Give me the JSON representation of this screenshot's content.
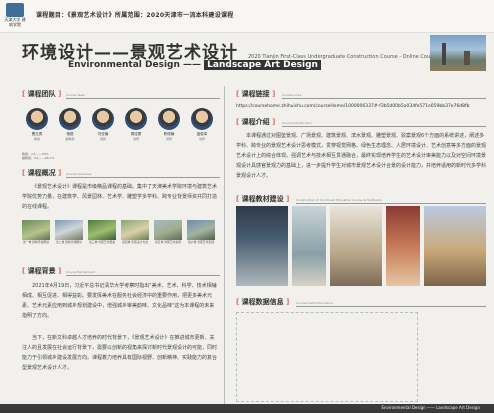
{
  "topbar": {
    "logo_text": "天津大学\n建筑学院",
    "title": "课程题目：《景观艺术设计》所属范围：2020天津市一流本科建设课程"
  },
  "header": {
    "title_cn": "环境设计——景观艺术设计",
    "title_en_prefix": "Environmental Design —— ",
    "title_en_highlight": "Landscape Art Design",
    "subtitle_en": "2020 Tianjin First-Class Undergraduate Construction Course - Online Courses -"
  },
  "sections": {
    "team": {
      "title": "课程团队",
      "sub": "Course Team"
    },
    "overview": {
      "title": "课程概况",
      "sub": "Course Overview"
    },
    "background": {
      "title": "课程背景",
      "sub": "Course Background"
    },
    "link": {
      "title": "课程链接",
      "sub": "Course Links"
    },
    "intro": {
      "title": "课程介绍",
      "sub": "Course Introduction"
    },
    "materials": {
      "title": "课程教材建设",
      "sub": "Construction of Continued Education Course & Textbooks"
    },
    "data": {
      "title": "课程数据信息",
      "sub": "Course Data Information"
    }
  },
  "team_members": [
    {
      "name": "曹文勇",
      "role": "教授"
    },
    {
      "name": "杨振",
      "role": "副教授"
    },
    {
      "name": "刘亚楠",
      "role": "讲师"
    },
    {
      "name": "周佳蕾",
      "role": "讲师"
    },
    {
      "name": "陈硕楠",
      "role": "讲师"
    },
    {
      "name": "蓝俊军",
      "role": "讲师"
    }
  ],
  "team_info": "教授：2人——33%\n副教授：4人——66.7%",
  "overview_text": "《景观艺术设计》课程是市级精品课程的基础。集中了天津美术学院环境与建筑艺术学院优势力量，在建筑学、风景园林、艺术学、雕塑学多学科、跨专业背景师资共同打造的在线课程。",
  "overview_photos": [
    {
      "cap": "第一章 建筑环境概述"
    },
    {
      "cap": "第二章 建筑景观概论"
    },
    {
      "cap": "第三章 景观艺术要素"
    },
    {
      "cap": "第四章 景观设计方法"
    },
    {
      "cap": "第五章 景观艺术案例"
    },
    {
      "cap": "第六章 景观艺术实践"
    }
  ],
  "background_text_1": "2021年4月19日，习近平总书记清华大学考察时指出\"美术、艺术、科学、技术相辅相成、相互促进、相得益彰。要发挥美术在服务社会经济中的重要作用，把更多美术元素、艺术元素应用到城乡规划建设中，增强城乡审美韵味、文化品味\"这为本课程的未来指明了方向。",
  "background_text_2": "当下，在新文科卓越人才培养的时代背景下，《景观艺术设计》在推进城市更新、关注人的且发展在社会运行背景下，需要以创新的视角来探讨新时代景观设计的可能，同时能力于引领城乡建设发展方向。课程着力培养具有国际视野、创新精神、实践能力的复合型景观艺术设计人才。",
  "link_url": "https://coursehome.zhihuishu.com/courseHome/1000006337#-f3b5d00b5a034fe571e059bb37e76d8fb",
  "intro_text": "本课程通过对图鉴景观、广场景观、建筑景观、滨水景观、雕塑景观、驳案景观6个方面的系统讲述，阐述多学科、跨专业的景观艺术设计思考模式，贯穿视觉网格、绿色生态理念、人居环境设计、艺术创意等多方面的景观艺术设计上的综合体现。强调艺术与技术相互贯通融合，最终实现培养学生的艺术设计审美能力以及对空间环境景观设计具感官景观力的基础上，进一步提升学生对城市景观艺术设计合景的设计能力，并培养适用的新时代多学科景观设计人才。",
  "footer_text": "Environmental Design —— Landscape Art Design"
}
